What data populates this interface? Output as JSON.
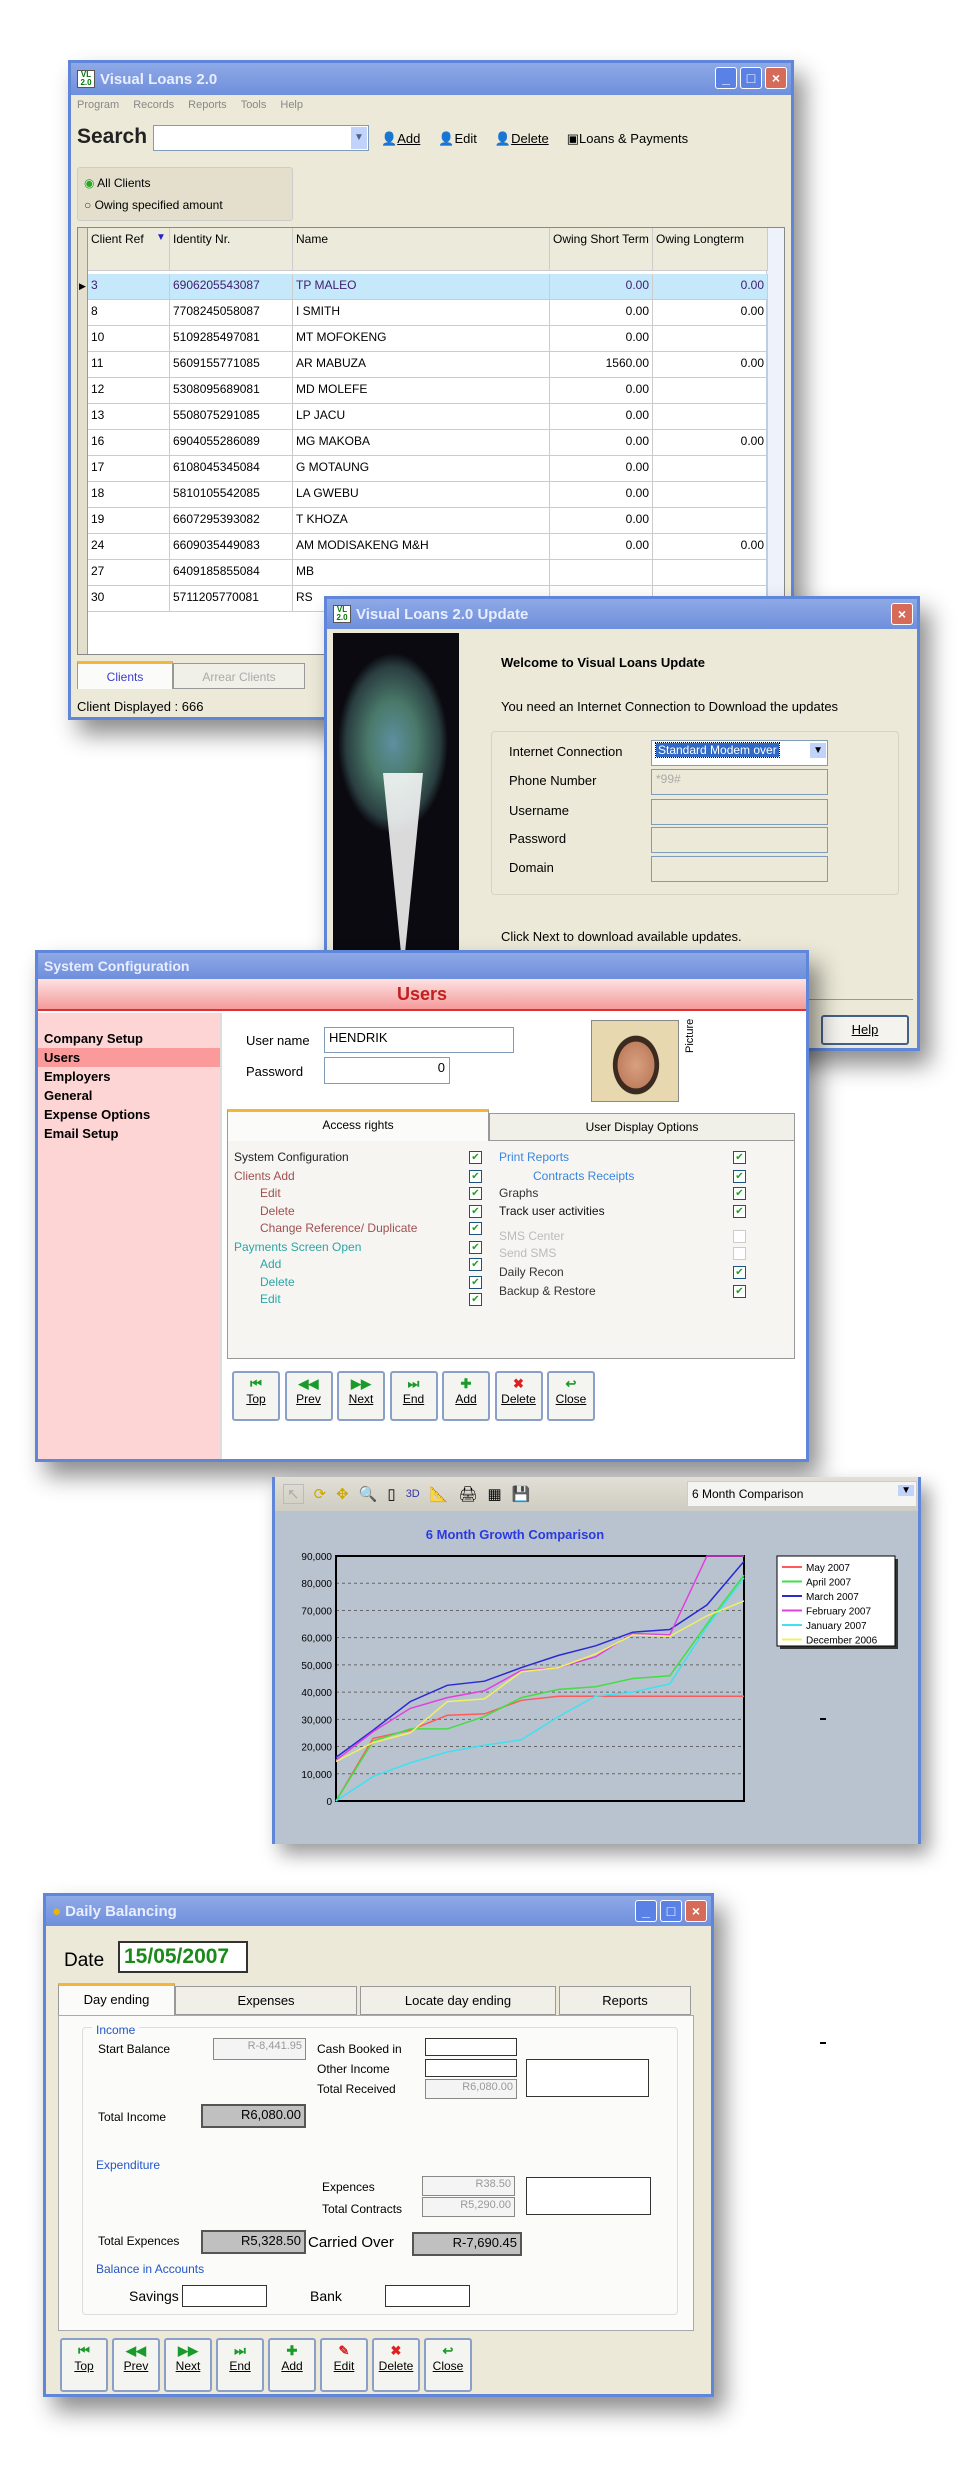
{
  "main_window": {
    "title": "Visual Loans 2.0",
    "icon_text": "VL 2.0",
    "menu": [
      "Program",
      "Records",
      "Reports",
      "Tools",
      "Help"
    ],
    "search_label": "Search",
    "search_value": "",
    "toolbar": {
      "add": "Add",
      "edit": "Edit",
      "delete": "Delete",
      "loans": "Loans & Payments"
    },
    "filter": {
      "all_clients": "All Clients",
      "owing": "Owing specified amount",
      "selected": "all_clients"
    },
    "columns": [
      "Client Ref",
      "Identity Nr.",
      "Name",
      "Owing Short Term",
      "Owing Longterm"
    ],
    "rows": [
      [
        "3",
        "6906205543087",
        "TP MALEO",
        "0.00",
        "0.00"
      ],
      [
        "8",
        "7708245058087",
        "I SMITH",
        "0.00",
        "0.00"
      ],
      [
        "10",
        "5109285497081",
        "MT MOFOKENG",
        "0.00",
        ""
      ],
      [
        "11",
        "5609155771085",
        "AR MABUZA",
        "1560.00",
        "0.00"
      ],
      [
        "12",
        "5308095689081",
        "MD MOLEFE",
        "0.00",
        ""
      ],
      [
        "13",
        "5508075291085",
        "LP JACU",
        "0.00",
        ""
      ],
      [
        "16",
        "6904055286089",
        "MG MAKOBA",
        "0.00",
        "0.00"
      ],
      [
        "17",
        "6108045345084",
        "G MOTAUNG",
        "0.00",
        ""
      ],
      [
        "18",
        "5810105542085",
        "LA GWEBU",
        "0.00",
        ""
      ],
      [
        "19",
        "6607295393082",
        "T KHOZA",
        "0.00",
        ""
      ],
      [
        "24",
        "6609035449083",
        "AM MODISAKENG           M&H",
        "0.00",
        "0.00"
      ],
      [
        "27",
        "6409185855084",
        "MB",
        "",
        ""
      ],
      [
        "30",
        "5711205770081",
        "RS",
        "",
        ""
      ]
    ],
    "tabs": [
      "Clients",
      "Arrear Clients"
    ],
    "status": "Client Displayed : 666"
  },
  "update_window": {
    "title": "Visual Loans 2.0 Update",
    "welcome": "Welcome to Visual Loans Update",
    "need_text": "You need an Internet Connection to Download the updates",
    "fields": [
      {
        "label": "Internet Connection",
        "value": "Standard Modem over"
      },
      {
        "label": "Phone Number",
        "value": "*99#"
      },
      {
        "label": "Username",
        "value": ""
      },
      {
        "label": "Password",
        "value": ""
      },
      {
        "label": "Domain",
        "value": ""
      }
    ],
    "click_next": "Click Next to download available updates.",
    "help": "Help"
  },
  "sysconfig": {
    "title": "System Configuration",
    "header": "Users",
    "nav": [
      "Company Setup",
      "Users",
      "Employers",
      "General",
      "Expense Options",
      "Email Setup"
    ],
    "nav_selected": "Users",
    "username_label": "User name",
    "username": "HENDRIK",
    "password_label": "Password",
    "password": "0",
    "picture_label": "Picture",
    "tabs": [
      "Access rights",
      "User Display Options"
    ],
    "left_rights": [
      {
        "label": "System Configuration",
        "checked": true,
        "color": "#222222",
        "indent": 0
      },
      {
        "label": "Clients Add",
        "checked": true,
        "color": "#a05050",
        "indent": 0
      },
      {
        "label": "Edit",
        "checked": true,
        "color": "#a05050",
        "indent": 1
      },
      {
        "label": "Delete",
        "checked": true,
        "color": "#a05050",
        "indent": 1
      },
      {
        "label": "Change Reference/ Duplicate",
        "checked": true,
        "color": "#a05050",
        "indent": 1
      },
      {
        "label": "Payments Screen Open",
        "checked": true,
        "color": "#2aa6a6",
        "indent": 0
      },
      {
        "label": "Add",
        "checked": true,
        "color": "#2aa6a6",
        "indent": 1
      },
      {
        "label": "Delete",
        "checked": true,
        "color": "#2aa6a6",
        "indent": 1
      },
      {
        "label": "Edit",
        "checked": true,
        "color": "#2aa6a6",
        "indent": 1
      }
    ],
    "right_rights": [
      {
        "label": "Print Reports",
        "checked": true,
        "color": "#3a86e0",
        "indent": 0
      },
      {
        "label": "Contracts Receipts",
        "checked": true,
        "color": "#3a86e0",
        "indent": 1
      },
      {
        "label": "Graphs",
        "checked": true,
        "color": "#333333",
        "indent": 0
      },
      {
        "label": "Track user activities",
        "checked": true,
        "color": "#111111",
        "indent": 0
      },
      {
        "label": "SMS Center",
        "checked": false,
        "color": "#bbbbbb",
        "indent": 0
      },
      {
        "label": "Send SMS",
        "checked": false,
        "color": "#bbbbbb",
        "indent": 0
      },
      {
        "label": "Daily Recon",
        "checked": true,
        "color": "#333333",
        "indent": 0
      },
      {
        "label": "Backup & Restore",
        "checked": true,
        "color": "#333333",
        "indent": 0
      }
    ],
    "buttons": [
      {
        "label": "Top",
        "icon": "first-icon"
      },
      {
        "label": "Prev",
        "icon": "prev-icon"
      },
      {
        "label": "Next",
        "icon": "next-icon"
      },
      {
        "label": "End",
        "icon": "last-icon"
      },
      {
        "label": "Add",
        "icon": "add-icon"
      },
      {
        "label": "Delete",
        "icon": "delete-icon"
      },
      {
        "label": "Close",
        "icon": "close-icon"
      }
    ]
  },
  "chart_window": {
    "selector": "6 Month Comparison",
    "toolbar_3d": "3D"
  },
  "chart_data": {
    "type": "line",
    "title": "6 Month Growth Comparison",
    "xlabel": "",
    "ylabel": "",
    "ylim": [
      0,
      90000
    ],
    "yticks": [
      "0",
      "10,000",
      "20,000",
      "30,000",
      "40,000",
      "50,000",
      "60,000",
      "70,000",
      "80,000",
      "90,000"
    ],
    "grid": true,
    "legend": "right",
    "series": [
      {
        "name": "May 2007",
        "color": "#ff5a5a",
        "values": [
          0,
          23000,
          26000,
          31500,
          32000,
          37000,
          38500,
          38500,
          38500,
          38500,
          38500,
          38500
        ]
      },
      {
        "name": "April 2007",
        "color": "#44dd44",
        "values": [
          0,
          22000,
          26500,
          26500,
          31000,
          38000,
          41000,
          42000,
          45000,
          46000,
          65000,
          83000
        ]
      },
      {
        "name": "March 2007",
        "color": "#2a2ad0",
        "values": [
          16000,
          26000,
          36500,
          42500,
          44000,
          49000,
          53500,
          57000,
          62000,
          63000,
          72000,
          88000
        ]
      },
      {
        "name": "February 2007",
        "color": "#e040e0",
        "values": [
          15000,
          25500,
          34000,
          38000,
          40500,
          48000,
          49000,
          53000,
          61500,
          61000,
          90000,
          90000
        ]
      },
      {
        "name": "January 2007",
        "color": "#40e0f0",
        "values": [
          0,
          9000,
          14000,
          18000,
          20500,
          22500,
          31000,
          38500,
          40000,
          43000,
          64000,
          82000
        ]
      },
      {
        "name": "December 2006",
        "color": "#f0f060",
        "values": [
          14500,
          21500,
          25000,
          36500,
          37500,
          47500,
          49000,
          54000,
          61000,
          60500,
          68000,
          73500
        ]
      }
    ]
  },
  "daily": {
    "title": "Daily Balancing",
    "date_label": "Date",
    "date": "15/05/2007",
    "tabs": [
      "Day ending",
      "Expenses",
      "Locate day ending",
      "Reports"
    ],
    "income_label": "Income",
    "start_balance_label": "Start Balance",
    "start_balance": "R-8,441.95",
    "cash_booked_label": "Cash Booked in",
    "cash_booked": "",
    "other_income_label": "Other Income",
    "other_income": "",
    "total_received_label": "Total Received",
    "total_received": "R6,080.00",
    "total_income_label": "Total Income",
    "total_income": "R6,080.00",
    "expenditure_label": "Expenditure",
    "expences_label": "Expences",
    "expences": "R38.50",
    "total_contracts_label": "Total Contracts",
    "total_contracts": "R5,290.00",
    "total_expences_label": "Total Expences",
    "total_expences": "R5,328.50",
    "carried_over_label": "Carried Over",
    "carried_over": "R-7,690.45",
    "balance_label": "Balance in Accounts",
    "savings_label": "Savings",
    "savings": "",
    "bank_label": "Bank",
    "bank": "",
    "buttons": [
      {
        "label": "Top",
        "icon": "first-icon"
      },
      {
        "label": "Prev",
        "icon": "prev-icon"
      },
      {
        "label": "Next",
        "icon": "next-icon"
      },
      {
        "label": "End",
        "icon": "last-icon"
      },
      {
        "label": "Add",
        "icon": "add-icon"
      },
      {
        "label": "Edit",
        "icon": "edit-icon"
      },
      {
        "label": "Delete",
        "icon": "delete-icon"
      },
      {
        "label": "Close",
        "icon": "close-icon"
      }
    ]
  }
}
